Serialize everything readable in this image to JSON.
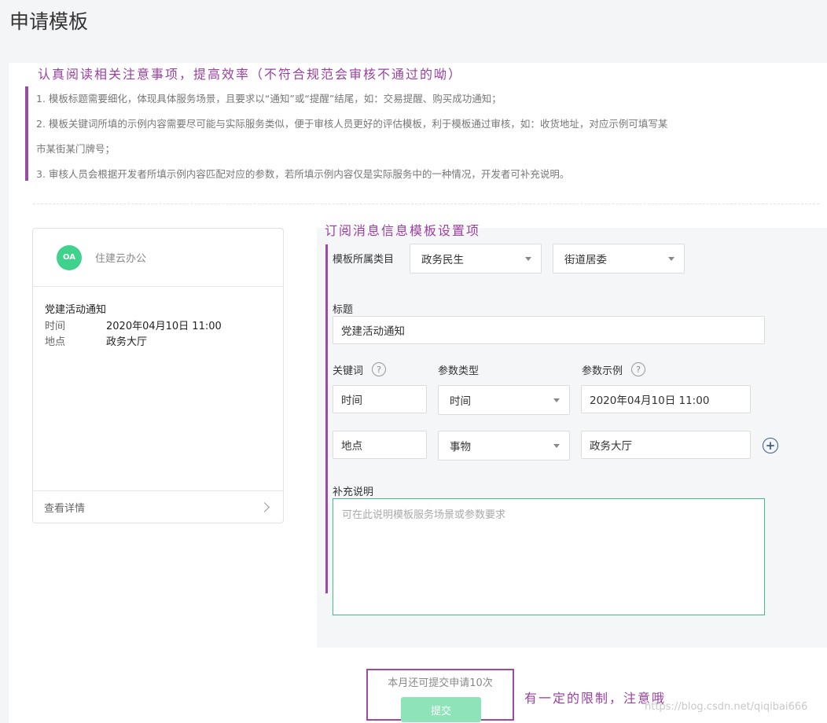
{
  "page": {
    "title": "申请模板"
  },
  "annotations": {
    "top": "认真阅读相关注意事项，提高效率（不符合规范会审核不通过的呦）",
    "middle": "订阅消息信息模板设置项",
    "bottom": "有一定的限制，注意哦"
  },
  "notes": [
    "1. 模板标题需要细化，体现具体服务场景，且要求以“通知”或“提醒”结尾，如：交易提醒、购买成功通知；",
    "2. 模板关键词所填的示例内容需要尽可能与实际服务类似，便于审核人员更好的评估模板，利于模板通过审核，如：收货地址，对应示例可填写某",
    "市某街某门牌号；",
    "3. 审核人员会根据开发者所填示例内容匹配对应的参数，若所填示例内容仅是实际服务中的一种情况，开发者可补充说明。"
  ],
  "preview": {
    "avatar": "OA",
    "app_name": "住建云办公",
    "title": "党建活动通知",
    "rows": [
      {
        "key": "时间",
        "value": "2020年04月10日 11:00"
      },
      {
        "key": "地点",
        "value": "政务大厅"
      }
    ],
    "footer_link": "查看详情"
  },
  "form": {
    "category_label": "模板所属类目",
    "category_primary": "政务民生",
    "category_secondary": "街道居委",
    "title_label": "标题",
    "title_value": "党建活动通知",
    "keyword_label": "关键词",
    "param_type_label": "参数类型",
    "param_example_label": "参数示例",
    "help_glyph": "?",
    "add_glyph": "+",
    "rows": [
      {
        "keyword": "时间",
        "type": "时间",
        "example": "2020年04月10日 11:00"
      },
      {
        "keyword": "地点",
        "type": "事物",
        "example": "政务大厅"
      }
    ],
    "supplement_label": "补充说明",
    "supplement_placeholder": "可在此说明模板服务场景或参数要求"
  },
  "submit": {
    "quota_text": "本月还可提交申请10次",
    "button_label": "提交"
  },
  "watermark": "https://blog.csdn.net/qiqibai666",
  "colors": {
    "accent_purple": "#9b4aa6",
    "avatar_green": "#3ed28c",
    "focus_green": "#3ec28a",
    "submit_disabled": "#8ee3b8"
  }
}
